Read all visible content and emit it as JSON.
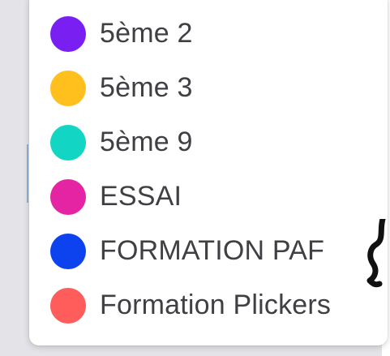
{
  "menu": {
    "items": [
      {
        "label": "5ème 2",
        "color": "#7a1ff2"
      },
      {
        "label": "5ème 3",
        "color": "#ffbf1c"
      },
      {
        "label": "5ème 9",
        "color": "#12d6c3"
      },
      {
        "label": "ESSAI",
        "color": "#e424a3"
      },
      {
        "label": "FORMATION PAF",
        "color": "#0c43ee"
      },
      {
        "label": "Formation Plickers",
        "color": "#ff5c5c"
      }
    ]
  },
  "icons": {
    "item_dot": "color-dot-icon",
    "partial_glyph": "scribble-icon"
  },
  "colors": {
    "label_text": "#3f3f44",
    "dropdown_bg": "#ffffff",
    "page_bg": "#e4e4e8"
  }
}
